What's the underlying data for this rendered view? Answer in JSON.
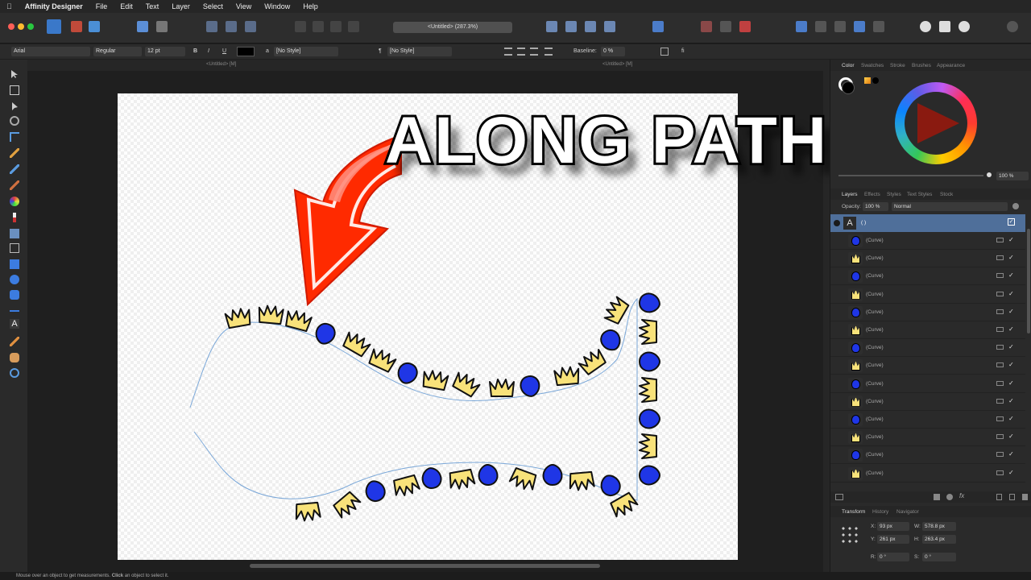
{
  "menubar": {
    "app_name": "Affinity Designer",
    "items": [
      "File",
      "Edit",
      "Text",
      "Layer",
      "Select",
      "View",
      "Window",
      "Help"
    ]
  },
  "toolbar": {
    "document_tab": "<Untitled> (287.3%)"
  },
  "context_toolbar": {
    "font_family": "Arial",
    "font_style": "Regular",
    "font_size": "12 pt",
    "bold": "B",
    "italic": "I",
    "underline": "U",
    "char_style": "[No Style]",
    "para_style": "[No Style]",
    "baseline_label": "Baseline:",
    "baseline_value": "0 %"
  },
  "doc_tabs": [
    "<Untitled> [M]",
    "<Untitled> [M]"
  ],
  "canvas": {
    "overlay_title": "ALONG PATH"
  },
  "color_panel": {
    "tabs": [
      "Color",
      "Swatches",
      "Stroke",
      "Brushes",
      "Appearance"
    ],
    "opacity_value": "100 %",
    "colors": {
      "red_arrow": "#ff2200",
      "shape_blue": "#1f36e6",
      "shape_yellow": "#f8e27a"
    }
  },
  "layers_panel": {
    "tabs": [
      "Layers",
      "Effects",
      "Styles",
      "Text Styles",
      "Stock"
    ],
    "opacity_label": "Opacity:",
    "opacity_value": "100 %",
    "blend_mode": "Normal",
    "group_name": "( )",
    "rows": [
      {
        "name": "(Curve)",
        "kind": "blue"
      },
      {
        "name": "(Curve)",
        "kind": "yellow"
      },
      {
        "name": "(Curve)",
        "kind": "blue"
      },
      {
        "name": "(Curve)",
        "kind": "yellow"
      },
      {
        "name": "(Curve)",
        "kind": "blue"
      },
      {
        "name": "(Curve)",
        "kind": "yellow"
      },
      {
        "name": "(Curve)",
        "kind": "blue"
      },
      {
        "name": "(Curve)",
        "kind": "yellow"
      },
      {
        "name": "(Curve)",
        "kind": "blue"
      },
      {
        "name": "(Curve)",
        "kind": "yellow"
      },
      {
        "name": "(Curve)",
        "kind": "blue"
      },
      {
        "name": "(Curve)",
        "kind": "yellow"
      },
      {
        "name": "(Curve)",
        "kind": "blue"
      },
      {
        "name": "(Curve)",
        "kind": "yellow"
      }
    ]
  },
  "transform_panel": {
    "tabs": [
      "Transform",
      "History",
      "Navigator"
    ],
    "x_label": "X:",
    "x_value": "93 px",
    "y_label": "Y:",
    "y_value": "261 px",
    "w_label": "W:",
    "w_value": "578.8 px",
    "h_label": "H:",
    "h_value": "263.4 px",
    "r_label": "R:",
    "r_value": "0 °",
    "s_label": "S:",
    "s_value": "0 °"
  },
  "status": {
    "prefix": "Mouse over an object to get measurements. ",
    "bold": "Click",
    "suffix": " an object to select it."
  }
}
